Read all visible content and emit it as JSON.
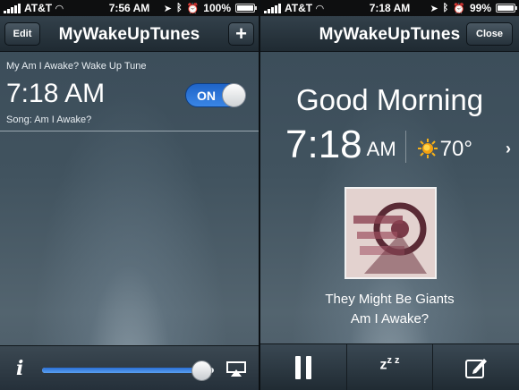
{
  "left": {
    "status": {
      "carrier": "AT&T",
      "time": "7:56 AM",
      "battery": "100%",
      "battery_level": 1.0
    },
    "nav": {
      "edit_label": "Edit",
      "title": "MyWakeUpTunes",
      "add_label": "+"
    },
    "alarm": {
      "label": "My Am I Awake? Wake Up Tune",
      "time": "7:18 AM",
      "song": "Song: Am I Awake?",
      "toggle_label": "ON",
      "enabled": true
    },
    "toolbar": {
      "info_label": "i",
      "volume_level": 0.93
    }
  },
  "right": {
    "status": {
      "carrier": "AT&T",
      "time": "7:18 AM",
      "battery": "99%",
      "battery_level": 0.99
    },
    "nav": {
      "title": "MyWakeUpTunes",
      "close_label": "Close"
    },
    "greeting": "Good Morning",
    "clock": {
      "time": "7:18",
      "ampm": "AM"
    },
    "weather": {
      "temperature": "70°",
      "icon": "sun-icon"
    },
    "now_playing": {
      "artist": "They Might Be Giants",
      "track": "Am I Awake?"
    },
    "toolbar": {
      "snooze_label": "z",
      "snooze_sup": "z z"
    }
  },
  "colors": {
    "accent_blue": "#2f7ae0",
    "nav_dark": "#1f2a32"
  }
}
